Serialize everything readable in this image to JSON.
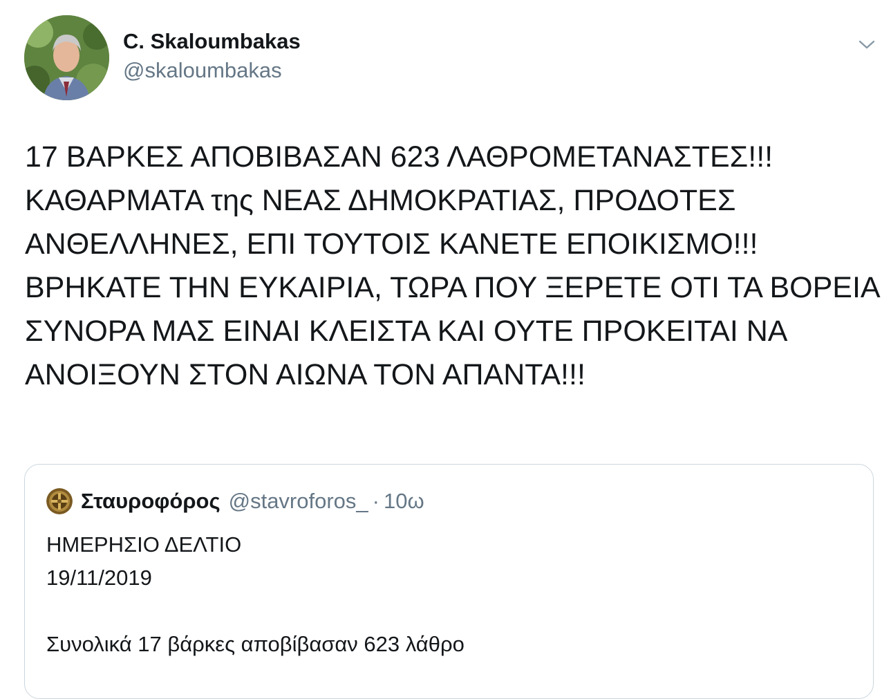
{
  "author": {
    "display_name": "C. Skaloumbakas",
    "handle": "@skaloumbakas"
  },
  "tweet": {
    "lines": [
      "17 ΒΑΡΚΕΣ ΑΠΟΒΙΒΑΣΑΝ 623 ΛΑΘΡΟΜΕΤΑΝΑΣΤΕΣ!!!",
      "ΚΑΘΑΡΜΑΤΑ της ΝΕΑΣ ΔΗΜΟΚΡΑΤΙΑΣ, ΠΡΟΔΟΤΕΣ",
      "ΑΝΘΕΛΛΗΝΕΣ, ΕΠΙ ΤΟΥΤΟΙΣ ΚΑΝΕΤΕ ΕΠΟΙΚΙΣΜΟ!!!",
      "ΒΡΗΚΑΤΕ ΤΗΝ ΕΥΚΑΙΡΙΑ, ΤΩΡΑ ΠΟΥ ΞΕΡΕΤΕ ΟΤΙ ΤΑ ΒΟΡΕΙΑ",
      "ΣΥΝΟΡΑ ΜΑΣ ΕΙΝΑΙ ΚΛΕΙΣΤΑ ΚΑΙ ΟΥΤΕ ΠΡΟΚΕΙΤΑΙ ΝΑ",
      "ΑΝΟΙΞΟΥΝ ΣΤΟΝ ΑΙΩΝΑ ΤΟΝ ΑΠΑΝΤΑ!!!"
    ]
  },
  "quoted_tweet": {
    "display_name": "Σταυροφόρος",
    "handle": "@stavroforos_",
    "separator": "·",
    "time": "10ω",
    "lines": [
      "ΗΜΕΡΗΣΙΟ ΔΕΛΤΙΟ",
      "19/11/2019",
      "",
      "Συνολικά 17 βάρκες αποβίβασαν 623 λάθρο"
    ]
  },
  "icons": {
    "menu": "chevron-down-icon",
    "author_avatar": "avatar",
    "quoted_avatar": "avatar"
  },
  "colors": {
    "text": "#14171a",
    "secondary": "#657786",
    "border": "#ccd6dd"
  }
}
